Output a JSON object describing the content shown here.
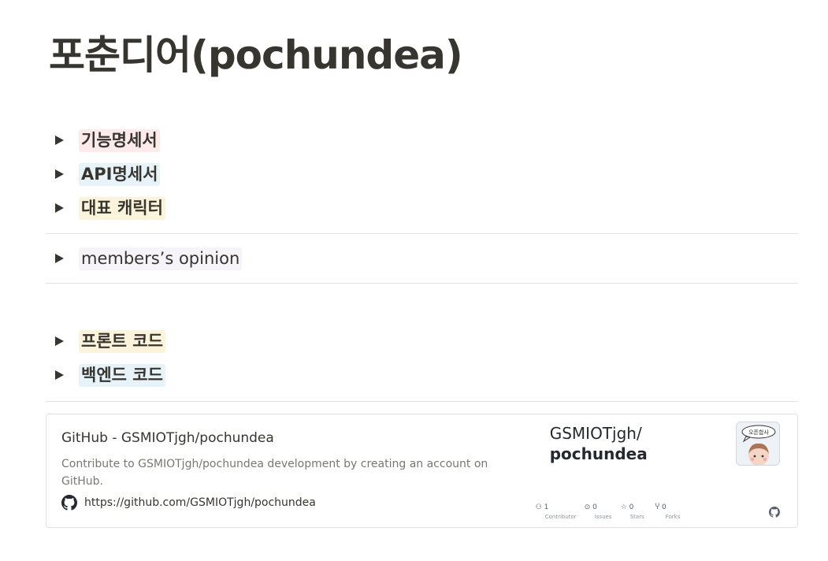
{
  "page": {
    "title": "포춘디어(pochundea)"
  },
  "toggles": [
    {
      "label": "기능명세서"
    },
    {
      "label": "API명세서"
    },
    {
      "label": "대표 캐릭터"
    },
    {
      "label": "members’s opinion"
    },
    {
      "label": "프론트 코드"
    },
    {
      "label": "백엔드 코드"
    }
  ],
  "bookmark": {
    "title": "GitHub - GSMIOTjgh/pochundea",
    "description": "Contribute to GSMIOTjgh/pochundea development by creating an account on GitHub.",
    "url": "https://github.com/GSMIOTjgh/pochundea",
    "card": {
      "owner": "GSMIOTjgh/",
      "repo": "pochundea",
      "avatar_bubble_text": "오픈합사",
      "stats": [
        {
          "icon": "contributors-icon",
          "value": "1",
          "label": "Contributor"
        },
        {
          "icon": "issues-icon",
          "value": "0",
          "label": "Issues"
        },
        {
          "icon": "star-icon",
          "value": "0",
          "label": "Stars"
        },
        {
          "icon": "fork-icon",
          "value": "0",
          "label": "Forks"
        }
      ]
    }
  },
  "colors": {
    "text": "#37352f",
    "red_bg": "#fdebec",
    "blue_bg": "#e7f3f8",
    "yellow_bg": "#fbf3db",
    "purple_bg": "#f6f3f9"
  }
}
